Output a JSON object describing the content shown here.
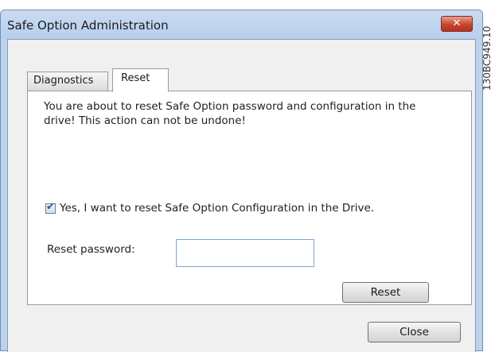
{
  "window": {
    "title": "Safe Option Administration",
    "close_glyph": "✕"
  },
  "tabs": [
    {
      "label": "Diagnostics",
      "active": false
    },
    {
      "label": "Reset",
      "active": true
    }
  ],
  "reset_panel": {
    "warning": "You are about to reset Safe Option password and configuration in the drive! This action can not be undone!",
    "confirm_checked": true,
    "confirm_label": "Yes, I want to reset Safe Option Configuration in the Drive.",
    "password_label": "Reset password:",
    "password_value": "",
    "reset_button": "Reset"
  },
  "footer": {
    "close_button": "Close"
  },
  "figure_code": "130BC949.10",
  "colors": {
    "titlebar": "#bcd3ee",
    "close_button": "#c7452f",
    "client_bg": "#f0f0f0",
    "input_border": "#7ea4d0"
  }
}
